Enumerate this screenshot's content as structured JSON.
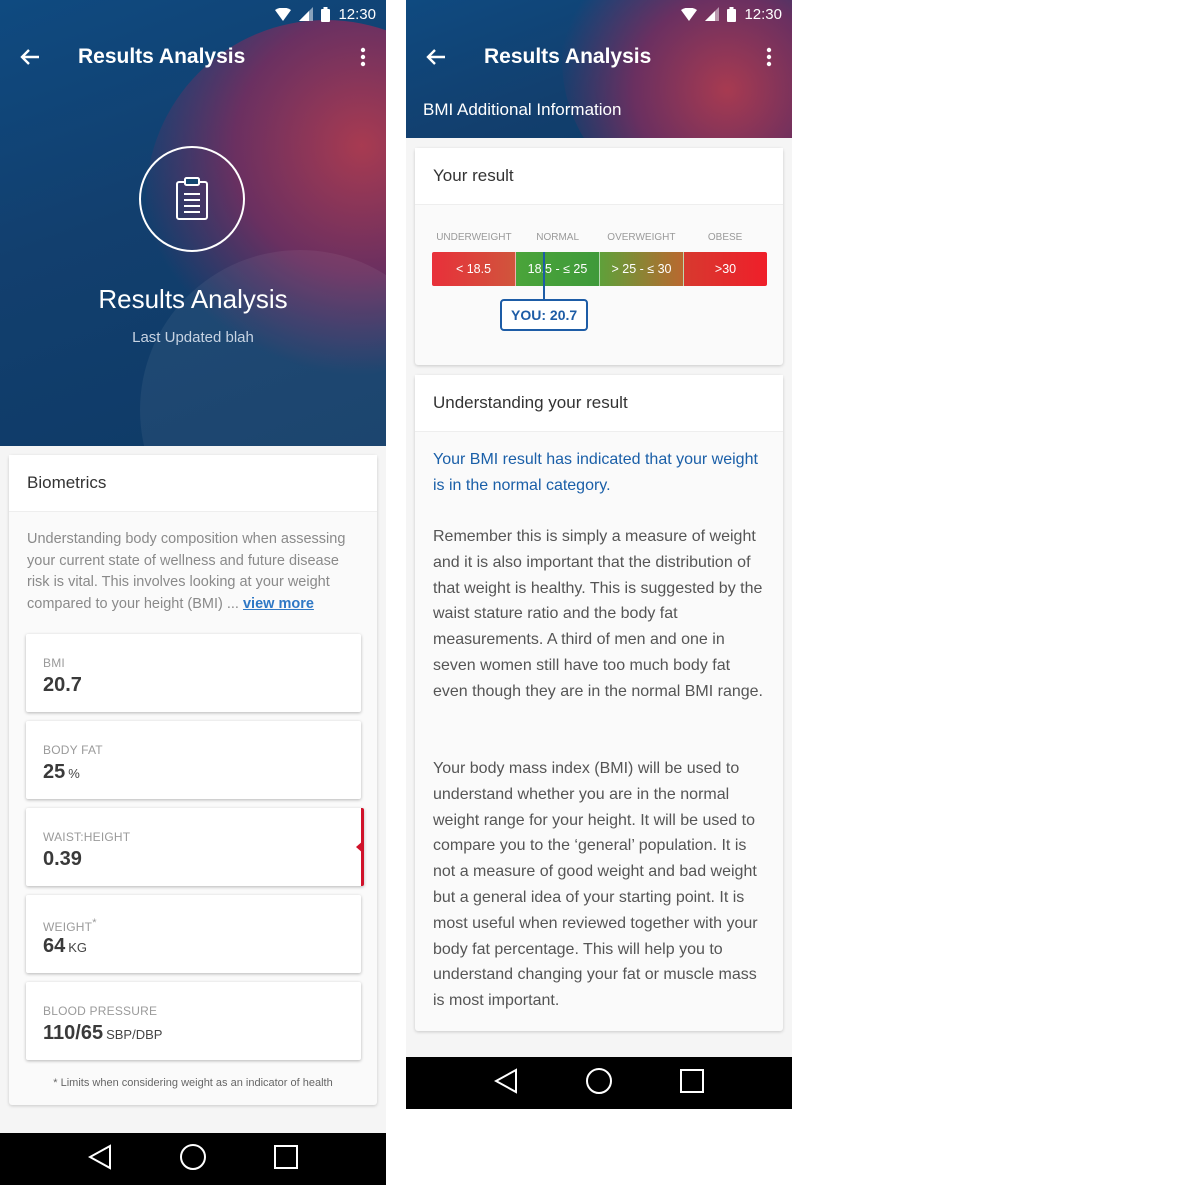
{
  "status_bar": {
    "time": "12:30"
  },
  "screen1": {
    "appbar_title": "Results Analysis",
    "hero": {
      "title": "Results Analysis",
      "subtitle": "Last Updated blah"
    },
    "card": {
      "title": "Biometrics",
      "intro": "Understanding body composition when assessing your current state of wellness and future disease risk is vital. This involves looking at your weight compared to your height (BMI) ...",
      "view_more": "view more"
    },
    "metrics": [
      {
        "label": "BMI",
        "value": "20.7",
        "unit": ""
      },
      {
        "label": "BODY FAT",
        "value": "25",
        "unit": "%"
      },
      {
        "label": "WAIST:HEIGHT",
        "value": "0.39",
        "unit": "",
        "flag_color": "#d0122a"
      },
      {
        "label": "WEIGHT",
        "label_sup": "*",
        "value": "64",
        "unit": "KG"
      },
      {
        "label": "BLOOD PRESSURE",
        "value": "110/65",
        "unit": "SBP/DBP"
      }
    ],
    "footnote": "* Limits when considering weight as an indicator of health"
  },
  "screen2": {
    "appbar_title": "Results Analysis",
    "subtitle": "BMI Additional Information",
    "result_card": {
      "title": "Your result",
      "categories": [
        "UNDERWEIGHT",
        "NORMAL",
        "OVERWEIGHT",
        "OBESE"
      ],
      "ranges": [
        "< 18.5",
        "18.5 - ≤ 25",
        "> 25 - ≤ 30",
        ">30"
      ],
      "you_label": "YOU: 20.7",
      "you_value": 20.7
    },
    "understanding_card": {
      "title": "Understanding your result",
      "highlight": "Your BMI result has indicated that your weight is in the normal category.",
      "paragraph1": "Remember this is simply a measure of weight and it is also important that the distribution of that weight is healthy. This is suggested by the waist stature ratio and the body fat measurements. A third of men and one in seven women still have too much body fat even though they are in the normal BMI range.",
      "paragraph2": "Your body mass index (BMI) will be used to understand whether you are in the normal weight range for your height. It will be used to compare you to the ‘general’ population. It is not a measure of good weight and bad weight but a general idea of your starting point. It is most useful when reviewed together with your body fat percentage. This will help you to understand changing your fat or muscle mass is most important."
    }
  },
  "colors": {
    "header_blue": "#0f4a80",
    "link_blue": "#2f78c5",
    "highlight_blue": "#1a5fa8",
    "underweight": "#e03838",
    "normal": "#3f9e3a",
    "overweight": "#7f9a35",
    "obese": "#e8222a",
    "flag_red": "#d0122a"
  },
  "icons": [
    "back-arrow-icon",
    "more-vert-icon",
    "wifi-icon",
    "signal-icon",
    "battery-icon",
    "clipboard-icon",
    "nav-back-icon",
    "nav-home-icon",
    "nav-recents-icon"
  ]
}
